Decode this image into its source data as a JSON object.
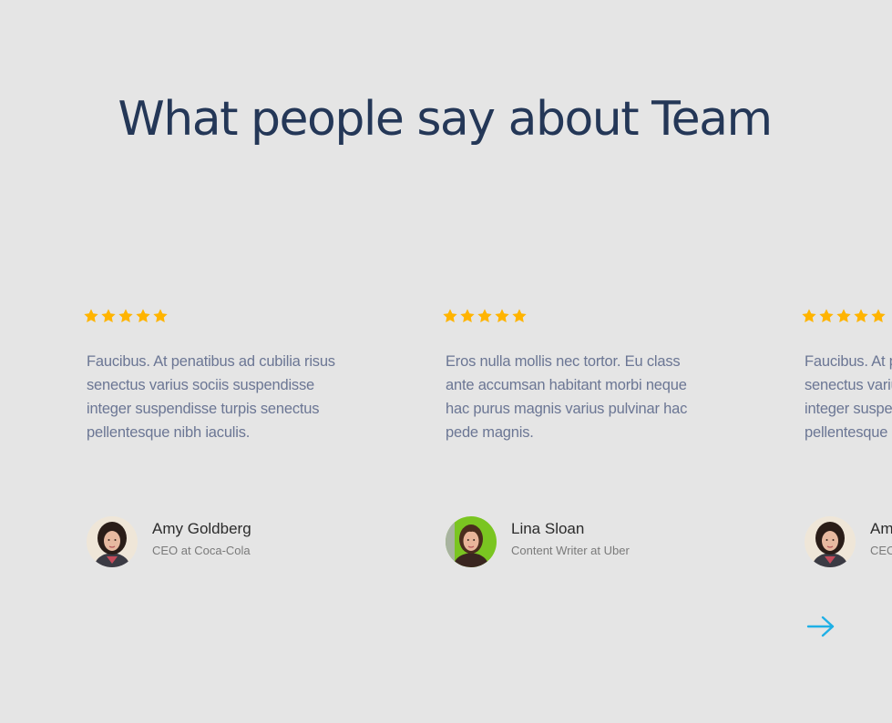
{
  "section": {
    "title": "What people say about Team"
  },
  "colors": {
    "background": "#e5e5e5",
    "title": "#243757",
    "star": "#ffb400",
    "quote": "#6b7694",
    "arrow": "#1fb0e6"
  },
  "testimonials": [
    {
      "rating": 5,
      "quote": "Faucibus. At penatibus ad cubilia risus senectus varius sociis suspendisse integer suspendisse turpis senectus pellentesque nibh iaculis.",
      "name": "Amy Goldberg",
      "role": "CEO at Coca-Cola",
      "avatar_icon": "avatar-amy"
    },
    {
      "rating": 5,
      "quote": "Eros nulla mollis nec tortor. Eu class ante accumsan habitant morbi neque hac purus magnis varius pulvinar hac pede magnis.",
      "name": "Lina Sloan",
      "role": "Content Writer at Uber",
      "avatar_icon": "avatar-lina"
    },
    {
      "rating": 5,
      "quote": "Faucibus. At penatibus ad cubilia risus senectus varius sociis suspendisse integer suspendisse turpis senectus pellentesque nibh iaculis.",
      "name": "Amy Goldberg",
      "role": "CEO at Coca-Cola",
      "avatar_icon": "avatar-amy"
    }
  ],
  "navigation": {
    "next_icon": "arrow-right-icon"
  }
}
